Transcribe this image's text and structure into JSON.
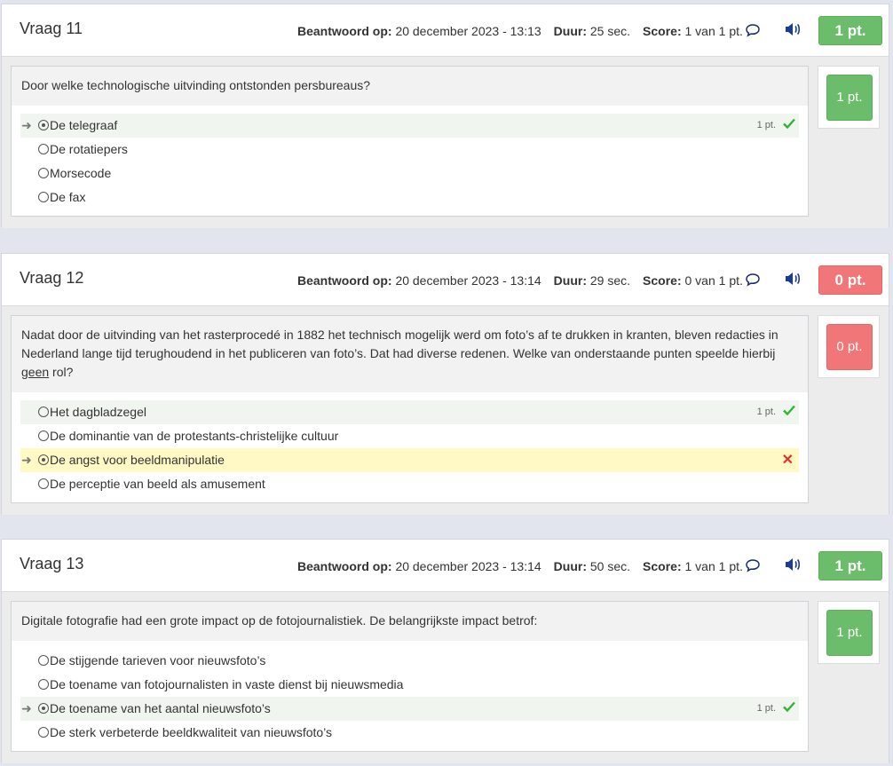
{
  "questions": [
    {
      "title": "Vraag 11",
      "answered_label": "Beantwoord op:",
      "answered_value": "20 december 2023 - 13:13",
      "duration_label": "Duur:",
      "duration_value": "25 sec.",
      "score_label": "Score:",
      "score_value": "1 van 1 pt.",
      "score_badge": "1 pt.",
      "result": "correct",
      "stem": "Door welke technologische uitvinding ontstonden persbureaus?",
      "options": [
        {
          "label": "De telegraaf",
          "selected": true,
          "points": "1 pt.",
          "correct": true
        },
        {
          "label": "De rotatiepers"
        },
        {
          "label": "Morsecode"
        },
        {
          "label": "De fax"
        }
      ]
    },
    {
      "title": "Vraag 12",
      "answered_label": "Beantwoord op:",
      "answered_value": "20 december 2023 - 13:14",
      "duration_label": "Duur:",
      "duration_value": "29 sec.",
      "score_label": "Score:",
      "score_value": "0 van 1 pt.",
      "score_badge": "0 pt.",
      "result": "wrong",
      "stem_before": "Nadat door de uitvinding van het rasterprocedé in 1882 het technisch mogelijk werd om foto’s af te drukken in kranten, bleven redacties in Nederland lange tijd terughoudend in het publiceren van foto’s. Dat had diverse redenen. Welke van onderstaande punten speelde hierbij ",
      "stem_underlined": "geen",
      "stem_after": " rol?",
      "options": [
        {
          "label": "Het dagbladzegel",
          "points": "1 pt.",
          "correct": true
        },
        {
          "label": "De dominantie van de protestants-christelijke cultuur"
        },
        {
          "label": "De angst voor beeldmanipulatie",
          "selected": true,
          "wrong": true
        },
        {
          "label": "De perceptie van beeld als amusement"
        }
      ]
    },
    {
      "title": "Vraag 13",
      "answered_label": "Beantwoord op:",
      "answered_value": "20 december 2023 - 13:14",
      "duration_label": "Duur:",
      "duration_value": "50 sec.",
      "score_label": "Score:",
      "score_value": "1 van 1 pt.",
      "score_badge": "1 pt.",
      "result": "correct",
      "stem": "Digitale fotografie had een grote impact op de fotojournalistiek. De belangrijkste impact betrof:",
      "options": [
        {
          "label": "De stijgende tarieven voor nieuwsfoto’s"
        },
        {
          "label": "De toename van fotojournalisten in vaste dienst bij nieuwsmedia"
        },
        {
          "label": "De toename van het aantal nieuwsfoto’s",
          "selected": true,
          "points": "1 pt.",
          "correct": true
        },
        {
          "label": "De sterk verbeterde beeldkwaliteit van nieuwsfoto’s"
        }
      ]
    }
  ],
  "icons": {
    "comment": "comment-icon",
    "audio": "speaker-icon",
    "arrow": "arrow-right-icon",
    "check": "checkmark-icon",
    "cross": "cross-icon"
  },
  "colors": {
    "correct": "#6cbd6b",
    "wrong": "#f07677",
    "highlight_correct": "#f0f6ef",
    "highlight_wrong": "#fffac5"
  }
}
